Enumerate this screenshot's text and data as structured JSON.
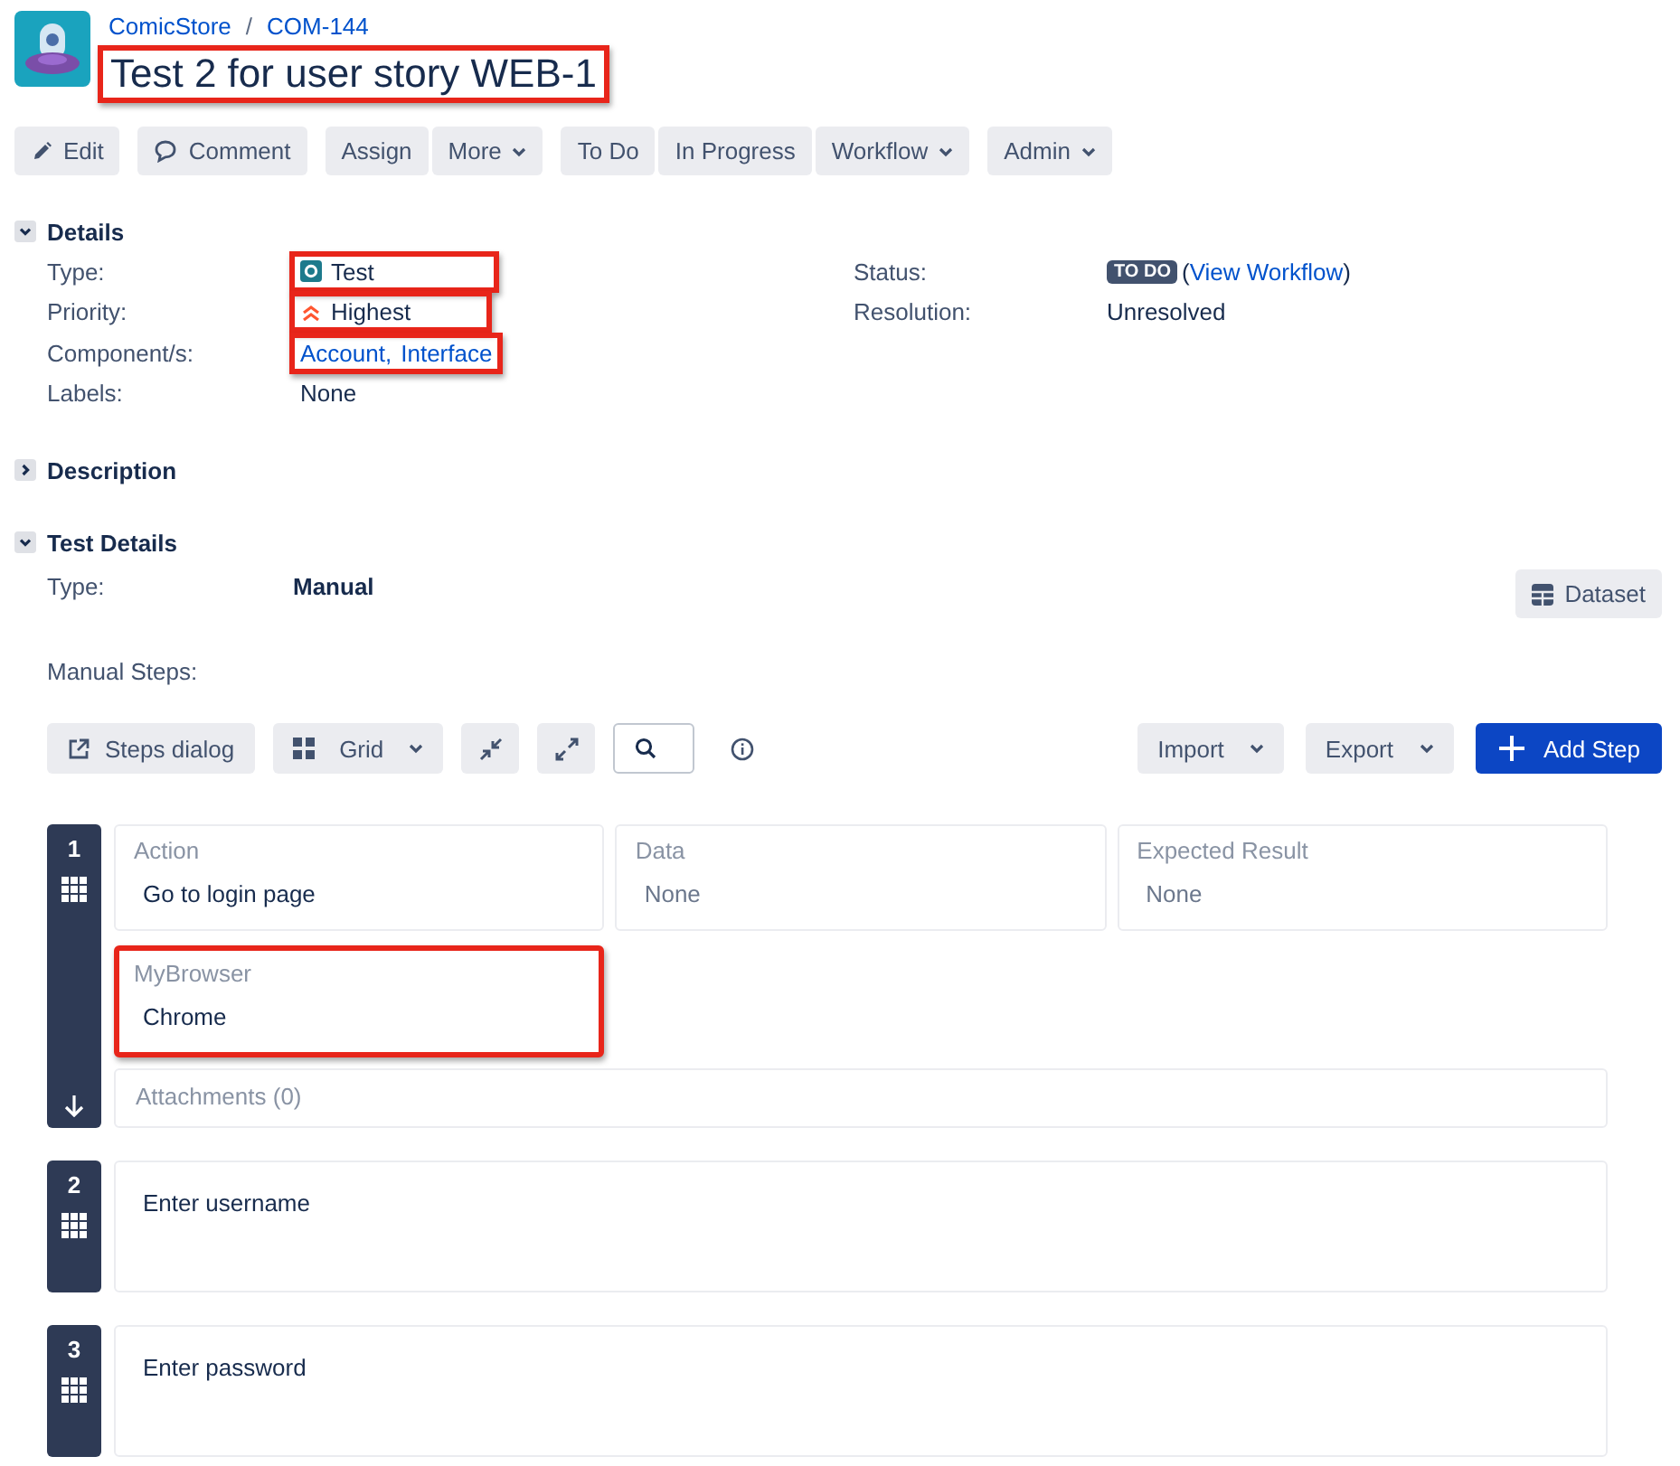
{
  "breadcrumb": {
    "items": [
      {
        "label": "ComicStore"
      },
      {
        "label": "COM-144"
      }
    ],
    "separator": "/"
  },
  "issue_title": {
    "text": "Test 2 for user story WEB-1",
    "highlighted": true
  },
  "toolbar": [
    [
      {
        "label": "Edit",
        "kind": "edit",
        "dropdown": false
      }
    ],
    [
      {
        "label": "Comment",
        "kind": "comment",
        "dropdown": false
      }
    ],
    [
      {
        "label": "Assign",
        "kind": "plain",
        "dropdown": false
      },
      {
        "label": "More",
        "kind": "plain",
        "dropdown": true
      }
    ],
    [
      {
        "label": "To Do",
        "kind": "plain",
        "dropdown": false
      },
      {
        "label": "In Progress",
        "kind": "plain",
        "dropdown": false
      },
      {
        "label": "Workflow",
        "kind": "plain",
        "dropdown": true
      }
    ],
    [
      {
        "label": "Admin",
        "kind": "plain",
        "dropdown": true
      }
    ]
  ],
  "details": {
    "title": "Details",
    "expanded": true,
    "left": [
      {
        "label": "Type:",
        "kind": "issue-type",
        "value": "Test",
        "highlighted": true
      },
      {
        "label": "Priority:",
        "kind": "priority",
        "value": "Highest",
        "highlighted": true
      },
      {
        "label": "Component/s:",
        "kind": "links",
        "links": [
          "Account",
          "Interface"
        ],
        "separator": ",",
        "highlighted": true
      },
      {
        "label": "Labels:",
        "kind": "text",
        "value": "None",
        "highlighted": false
      }
    ],
    "right": [
      {
        "label": "Status:",
        "kind": "status",
        "badge": "TO DO",
        "before": "(",
        "link": "View Workflow",
        "after": ")",
        "highlighted": false
      },
      {
        "label": "Resolution:",
        "kind": "text",
        "value": "Unresolved",
        "highlighted": false
      }
    ]
  },
  "description": {
    "title": "Description",
    "expanded": false
  },
  "test_details": {
    "title": "Test Details",
    "expanded": true,
    "type_label": "Type:",
    "type_value": "Manual",
    "dataset_button": "Dataset",
    "steps_label": "Manual Steps:",
    "steps_toolbar_left": [
      {
        "kind": "open-dialog",
        "label": "Steps dialog",
        "dropdown": false
      },
      {
        "kind": "grid",
        "label": "Grid",
        "dropdown": true
      },
      {
        "kind": "collapse",
        "dropdown": false
      },
      {
        "kind": "expand",
        "dropdown": false
      },
      {
        "kind": "search",
        "dropdown": false
      },
      {
        "kind": "info"
      }
    ],
    "steps_toolbar_right": [
      {
        "kind": "plain",
        "label": "Import",
        "dropdown": true
      },
      {
        "kind": "plain",
        "label": "Export",
        "dropdown": true
      },
      {
        "kind": "add",
        "label": "Add Step",
        "dropdown": false
      }
    ],
    "steps": [
      {
        "number": "1",
        "expanded": true,
        "fields": [
          {
            "label": "Action",
            "value": "Go to login page",
            "empty": false
          },
          {
            "label": "Data",
            "value": "None",
            "empty": true
          },
          {
            "label": "Expected Result",
            "value": "None",
            "empty": true
          }
        ],
        "custom_field": {
          "label": "MyBrowser",
          "value": "Chrome",
          "highlighted": true
        },
        "attachments": "Attachments (0)"
      },
      {
        "number": "2",
        "expanded": false,
        "fields": [
          {
            "value": "Enter username",
            "empty": false
          }
        ]
      },
      {
        "number": "3",
        "expanded": false,
        "fields": [
          {
            "value": "Enter password",
            "empty": false
          }
        ]
      }
    ]
  }
}
